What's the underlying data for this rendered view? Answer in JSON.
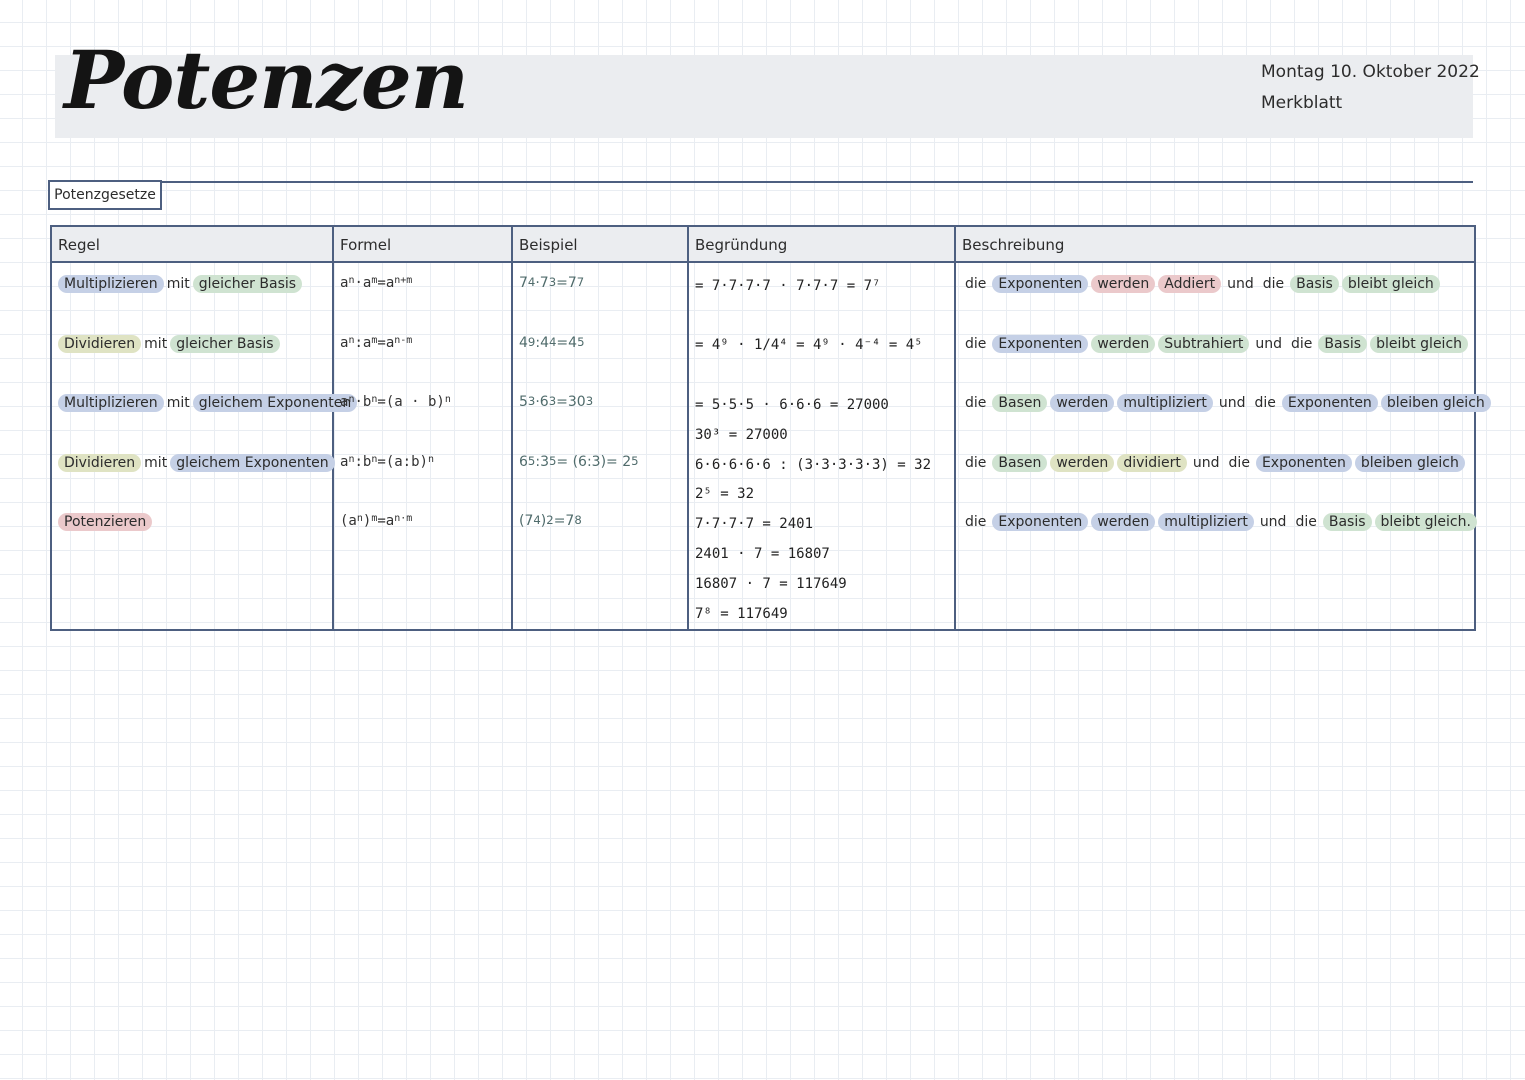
{
  "header": {
    "title": "Potenzen",
    "date": "Montag 10. Oktober 2022",
    "doc_type": "Merkblatt"
  },
  "section_label": "Potenzgesetze",
  "table": {
    "headers": [
      "Regel",
      "Formel",
      "Beispiel",
      "Begründung",
      "Beschreibung"
    ],
    "rules": [
      {
        "a": "Multiplizieren",
        "b": "mit",
        "c": "gleicher Basis"
      },
      {
        "a": "Dividieren",
        "b": "mit",
        "c": "gleicher Basis"
      },
      {
        "a": "Multiplizieren",
        "b": "mit",
        "c": "gleichem Exponenten"
      },
      {
        "a": "Dividieren",
        "b": "mit",
        "c": "gleichem Exponenten"
      },
      {
        "a": "Potenzieren",
        "b": "",
        "c": ""
      }
    ],
    "formulas": [
      {
        "left": "a",
        "lsup": "n",
        "op": " · ",
        "mid": "a",
        "msup": "m",
        "eq": " = ",
        "right": "a",
        "rsup": "n+m"
      },
      {
        "left": "a",
        "lsup": "n",
        "op": " : ",
        "mid": "a",
        "msup": "m",
        "eq": " = ",
        "right": "a",
        "rsup": "n-m"
      },
      {
        "left": "a",
        "lsup": "n",
        "op": " · ",
        "mid": "b",
        "msup": "n",
        "eq": " = ",
        "right": "(a · b)",
        "rsup": "n"
      },
      {
        "left": "a",
        "lsup": "n",
        "op": " : ",
        "mid": "b",
        "msup": "n",
        "eq": " = ",
        "right": "(a:b)",
        "rsup": "n"
      },
      {
        "left": "(a",
        "lsup": "n",
        "op": ")",
        "mid": "",
        "msup": "m",
        "eq": " = ",
        "right": "a",
        "rsup": "n·m"
      }
    ],
    "examples": [
      {
        "left": "7",
        "lsup": "4",
        "op": " · ",
        "mid": "7",
        "msup": "3",
        "eq": " = ",
        "right": "7",
        "rsup": "7"
      },
      {
        "left": "4",
        "lsup": "9",
        "op": " : ",
        "mid": "4",
        "msup": "4",
        "eq": " = ",
        "right": "4",
        "rsup": "5"
      },
      {
        "left": "5",
        "lsup": "3",
        "op": " · ",
        "mid": "6",
        "msup": "3",
        "eq": " = ",
        "right": "30",
        "rsup": "3"
      },
      {
        "left": "6",
        "lsup": "5",
        "op": " : ",
        "mid": "3",
        "msup": "5",
        "eq": " = (6:3)",
        "right": " = 2",
        "rsup": "5"
      },
      {
        "left": "(7",
        "lsup": "4",
        "op": ")",
        "mid": "",
        "msup": "2",
        "eq": " = ",
        "right": "7",
        "rsup": "8"
      }
    ],
    "reasoning_lines": [
      "= 7·7·7·7 · 7·7·7 = 7⁷",
      "",
      "= 4⁹ · 1/4⁴ = 4⁹ · 4⁻⁴ = 4⁵",
      "",
      "= 5·5·5 · 6·6·6 = 27000",
      "30³ = 27000",
      "6·6·6·6·6 : (3·3·3·3·3) = 32",
      "2⁵ = 32",
      "7·7·7·7 = 2401",
      "2401 · 7 = 16807",
      "16807 · 7 = 117649",
      "7⁸ = 117649"
    ],
    "descriptions": [
      {
        "w1": "die",
        "w2": "Exponenten",
        "w3": "werden",
        "w4": "Addiert",
        "w5": "und",
        "w6": "die",
        "w7": "Basis",
        "w8": "bleibt gleich"
      },
      {
        "w1": "die",
        "w2": "Exponenten",
        "w3": "werden",
        "w4": "Subtrahiert",
        "w5": "und",
        "w6": "die",
        "w7": "Basis",
        "w8": "bleibt gleich"
      },
      {
        "w1": "die",
        "w2": "Basen",
        "w3": "werden",
        "w4": "multipliziert",
        "w5": "und",
        "w6": "die",
        "w7": "Exponenten",
        "w8": "bleiben gleich"
      },
      {
        "w1": "die",
        "w2": "Basen",
        "w3": "werden",
        "w4": "dividiert",
        "w5": "und",
        "w6": "die",
        "w7": "Exponenten",
        "w8": "bleiben gleich"
      },
      {
        "w1": "die",
        "w2": "Exponenten",
        "w3": "werden",
        "w4": "multipliziert",
        "w5": "und",
        "w6": "die",
        "w7": "Basis",
        "w8": "bleibt gleich."
      }
    ]
  },
  "colors": {
    "border": "#4d5f80",
    "header_band": "#ebedf0",
    "highlight_blue": "#c5d0e6",
    "highlight_green": "#cfe3d1",
    "highlight_pink": "#ebc9cb",
    "highlight_olive": "#dfe3c3"
  }
}
